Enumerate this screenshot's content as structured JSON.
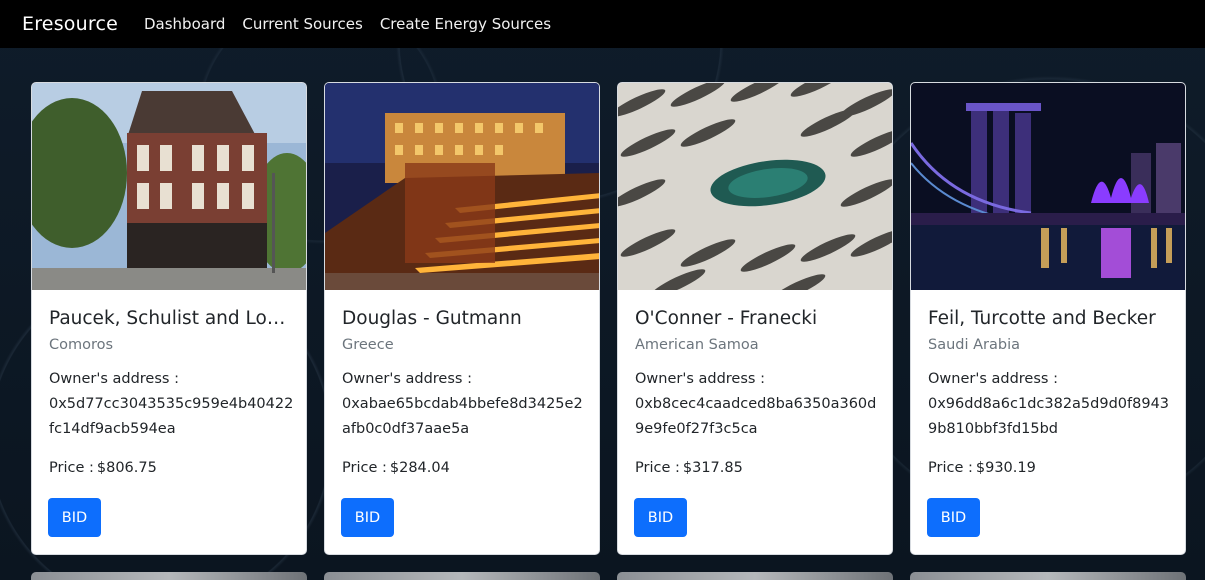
{
  "nav": {
    "brand": "Eresource",
    "links": [
      "Dashboard",
      "Current Sources",
      "Create Energy Sources"
    ]
  },
  "cards": [
    {
      "title": "Paucek, Schulist and Lock...",
      "country": "Comoros",
      "owner_label": "Owner's address :",
      "owner_address": "0x5d77cc3043535c959e4b40422fc14df9acb594ea",
      "price_label": "Price :",
      "price": "$806.75",
      "button": "BID"
    },
    {
      "title": "Douglas - Gutmann",
      "country": "Greece",
      "owner_label": "Owner's address :",
      "owner_address": "0xabae65bcdab4bbefe8d3425e2afb0c0df37aae5a",
      "price_label": "Price :",
      "price": "$284.04",
      "button": "BID"
    },
    {
      "title": "O'Conner - Franecki",
      "country": "American Samoa",
      "owner_label": "Owner's address :",
      "owner_address": "0xb8cec4caadced8ba6350a360d9e9fe0f27f3c5ca",
      "price_label": "Price :",
      "price": "$317.85",
      "button": "BID"
    },
    {
      "title": "Feil, Turcotte and Becker",
      "country": "Saudi Arabia",
      "owner_label": "Owner's address :",
      "owner_address": "0x96dd8a6c1dc382a5d9d0f89439b810bbf3fd15bd",
      "price_label": "Price :",
      "price": "$930.19",
      "button": "BID"
    }
  ]
}
